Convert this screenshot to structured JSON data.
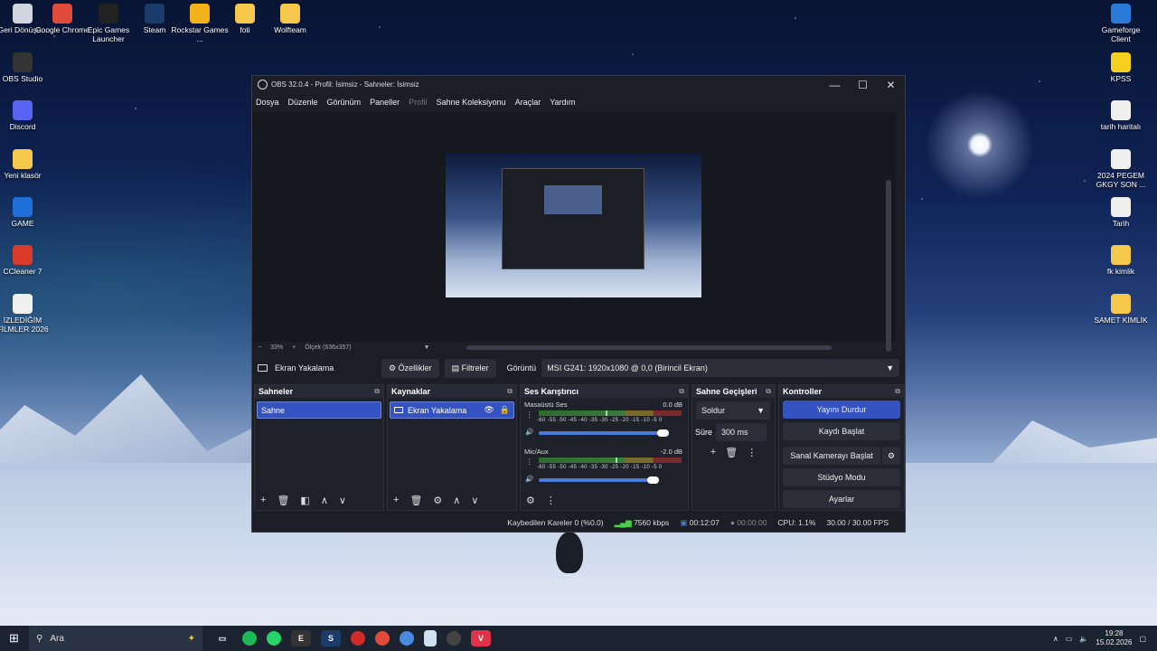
{
  "desktop_icons": [
    {
      "label": "Geri Dönüşü...",
      "icon": "recycle-bin-icon",
      "color": "#cfd6e0"
    },
    {
      "label": "Google Chrome",
      "icon": "chrome-icon",
      "color": "#e04a3a"
    },
    {
      "label": "Epic Games Launcher",
      "icon": "epic-games-icon",
      "color": "#222222"
    },
    {
      "label": "Steam",
      "icon": "steam-icon",
      "color": "#1b3b6a"
    },
    {
      "label": "Rockstar Games ...",
      "icon": "rockstar-icon",
      "color": "#f3b21b"
    },
    {
      "label": "foti",
      "icon": "folder-icon",
      "color": "#f5c84c"
    },
    {
      "label": "Wolfteam",
      "icon": "folder-icon",
      "color": "#f5c84c"
    },
    {
      "label": "OBS Studio",
      "icon": "obs-icon",
      "color": "#333333"
    },
    {
      "label": "Discord",
      "icon": "discord-icon",
      "color": "#5865f2"
    },
    {
      "label": "Yeni klasör",
      "icon": "folder-icon",
      "color": "#f5c84c"
    },
    {
      "label": "GAME",
      "icon": "gear-icon",
      "color": "#1e6fd9"
    },
    {
      "label": "CCleaner 7",
      "icon": "ccleaner-icon",
      "color": "#d93a2a"
    },
    {
      "label": "İZLEDİĞİM FİLMLER 2026",
      "icon": "document-icon",
      "color": "#f0f0f0"
    },
    {
      "label": "Gameforge Client",
      "icon": "gameforge-icon",
      "color": "#2a7bd8"
    },
    {
      "label": "KPSS",
      "icon": "star-icon",
      "color": "#f5d020"
    },
    {
      "label": "tarih haritalı",
      "icon": "chrome-shortcut-icon",
      "color": "#f0f0f0"
    },
    {
      "label": "2024 PEGEM GKGY SON ...",
      "icon": "chrome-shortcut-icon",
      "color": "#f0f0f0"
    },
    {
      "label": "Tarih",
      "icon": "chrome-shortcut-icon",
      "color": "#f0f0f0"
    },
    {
      "label": "fk kimlik",
      "icon": "folder-icon",
      "color": "#f5c84c"
    },
    {
      "label": "SAMET KİMLİK",
      "icon": "folder-icon",
      "color": "#f5c84c"
    }
  ],
  "window": {
    "title": "OBS 32.0.4 - Profil: İsimsiz - Sahneler: İsimsiz",
    "min": "—",
    "max": "☐",
    "close": "✕"
  },
  "menu": [
    "Dosya",
    "Düzenle",
    "Görünüm",
    "Paneller",
    "Profil",
    "Sahne Koleksiyonu",
    "Araçlar",
    "Yardım"
  ],
  "zoom": {
    "minus": "−",
    "value": "33%",
    "plus": "+",
    "scale": "Ölçek (636x357)"
  },
  "source_bar": {
    "source": "Ekran Yakalama",
    "properties": "Özellikler",
    "filters": "Filtreler",
    "display_label": "Görüntü",
    "display_value": "MSI G241: 1920x1080 @ 0,0 (Birincil Ekran)"
  },
  "scenes": {
    "title": "Sahneler",
    "selected": "Sahne"
  },
  "sources": {
    "title": "Kaynaklar",
    "selected": "Ekran Yakalama"
  },
  "mixer": {
    "title": "Ses Karıştırıcı",
    "scale": "-60 -55 -50 -45 -40 -35 -30 -25 -20 -15 -10 -5 0",
    "channels": [
      {
        "name": "Masaüstü Ses",
        "db": "0.0 dB",
        "level": 0.47
      },
      {
        "name": "Mic/Aux",
        "db": "-2.0 dB",
        "level": 0.54
      }
    ]
  },
  "transitions": {
    "title": "Sahne Geçişleri",
    "type": "Soldur",
    "duration_label": "Süre",
    "duration": "300 ms"
  },
  "controls": {
    "title": "Kontroller",
    "stop_stream": "Yayını Durdur",
    "start_record": "Kaydı Başlat",
    "virtual_cam": "Sanal Kamerayı Başlat",
    "studio": "Stüdyo Modu",
    "settings": "Ayarlar"
  },
  "status": {
    "dropped": "Kaybedilen Kareler 0 (%0.0)",
    "bitrate": "7560 kbps",
    "stream_time": "00:12:07",
    "record_time": "00:00:00",
    "cpu": "CPU: 1.1%",
    "fps": "30.00 / 30.00 FPS"
  },
  "taskbar": {
    "search": "Ara",
    "time": "19:28",
    "date": "15.02.2026"
  }
}
